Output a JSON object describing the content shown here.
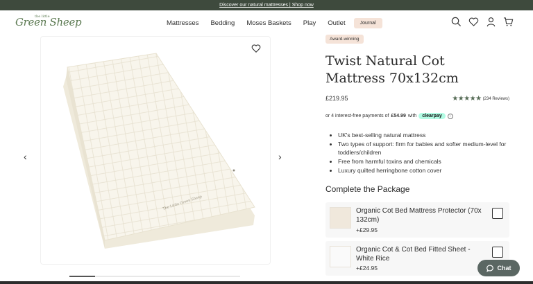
{
  "promo": {
    "text": "Discover our natural mattresses | Shop now"
  },
  "header": {
    "logo_small": "the little",
    "logo_main": "Green Sheep",
    "nav": [
      "Mattresses",
      "Bedding",
      "Moses Baskets",
      "Play",
      "Outlet"
    ],
    "nav_pill": "Journal",
    "icons": [
      "search-icon",
      "heart-icon",
      "account-icon",
      "cart-icon"
    ]
  },
  "gallery": {
    "image_alt": "Twist Natural Cot Mattress",
    "prev_arrow": "‹",
    "next_arrow": "›",
    "carousel_progress": 0.15
  },
  "product": {
    "badge": "Award-winning",
    "title": "Twist Natural Cot Mattress 70x132cm",
    "price": "£219.95",
    "rating": 4.5,
    "reviews": "(234 Reviews)",
    "pay_prefix": "or 4 interest-free payments of",
    "pay_amount": "£54.99",
    "pay_with": "with",
    "pay_brand": "clearpay",
    "features": [
      "UK's best-selling natural mattress",
      "Two types of support: firm for babies and softer medium-level for toddlers/children",
      "Free from harmful toxins and chemicals",
      "Luxury quilted herringbone cotton cover"
    ]
  },
  "package": {
    "heading": "Complete the Package",
    "items": [
      {
        "name": "Organic Cot Bed Mattress Protector (70x 132cm)",
        "price": "+£29.95"
      },
      {
        "name": "Organic Cot & Cot Bed Fitted Sheet - White Rice",
        "price": "+£24.95"
      }
    ]
  },
  "chat": {
    "label": "Chat"
  },
  "colors": {
    "brand_green": "#5c7a52",
    "promo_bar": "#3e4a3d",
    "pill": "#f5e3d8",
    "clearpay": "#b2fce4",
    "chat_button": "#5b6763"
  }
}
